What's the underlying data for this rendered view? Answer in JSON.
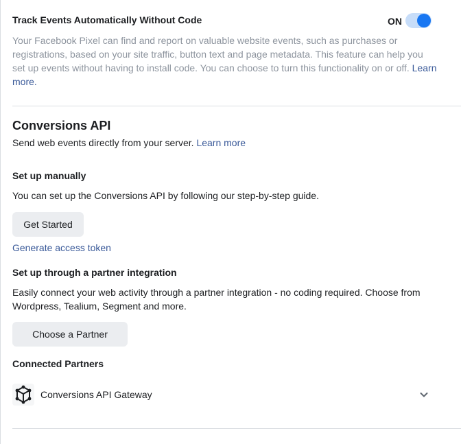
{
  "track_events": {
    "title": "Track Events Automatically Without Code",
    "toggle_label": "ON",
    "description": "Your Facebook Pixel can find and report on valuable website events, such as purchases or registrations, based on your site traffic, button text and page metadata. This feature can help you set up events without having to install code. You can choose to turn this functionality on or off.",
    "learn_more": "Learn more."
  },
  "conversions_api": {
    "title": "Conversions API",
    "subtitle": "Send web events directly from your server.",
    "learn_more": "Learn more"
  },
  "manual_setup": {
    "title": "Set up manually",
    "description": "You can set up the Conversions API by following our step-by-step guide.",
    "button_label": "Get Started",
    "token_link": "Generate access token"
  },
  "partner_setup": {
    "title": "Set up through a partner integration",
    "description": "Easily connect your web activity through a partner integration - no coding required. Choose from Wordpress, Tealium, Segment and more.",
    "button_label": "Choose a Partner"
  },
  "connected_partners": {
    "title": "Connected Partners",
    "items": [
      {
        "name": "Conversions API Gateway",
        "icon": "cube-network-icon"
      }
    ]
  },
  "colors": {
    "accent": "#1877f2",
    "link": "#385898",
    "muted_text": "#8d949e",
    "button_bg": "#ebedf0"
  }
}
